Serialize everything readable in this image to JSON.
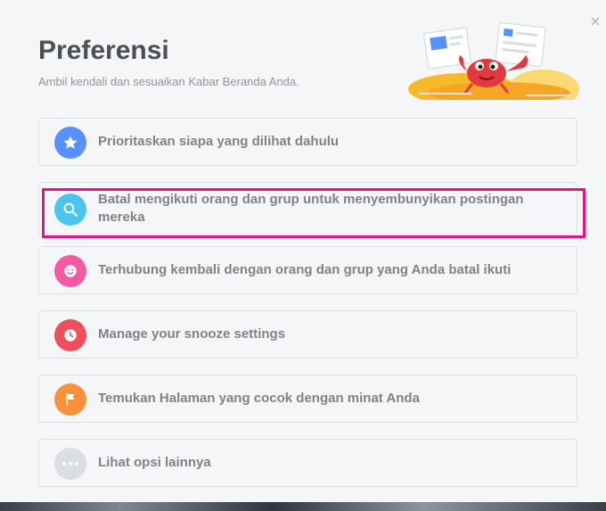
{
  "dialog": {
    "title": "Preferensi",
    "subtitle": "Ambil kendali dan sesuaikan Kabar Beranda Anda.",
    "close_glyph": "×"
  },
  "options": [
    {
      "label": "Prioritaskan siapa yang dilihat dahulu",
      "icon": "star-icon",
      "color": "#5890ff"
    },
    {
      "label": "Batal mengikuti orang dan grup untuk menyembunyikan postingan mereka",
      "icon": "search-icon",
      "color": "#4dc4f0",
      "highlighted": true
    },
    {
      "label": "Terhubung kembali dengan orang dan grup yang Anda batal ikuti",
      "icon": "smiley-icon",
      "color": "#f35aa3"
    },
    {
      "label": "Manage your snooze settings",
      "icon": "clock-icon",
      "color": "#ef4e5c"
    },
    {
      "label": "Temukan Halaman yang cocok dengan minat Anda",
      "icon": "flag-icon",
      "color": "#f7923a"
    },
    {
      "label": "Lihat opsi lainnya",
      "icon": "more-icon",
      "color": "#dadde1"
    }
  ],
  "colors": {
    "highlight_border": "#e8137f",
    "background": "#f5f6f7",
    "text": "#7f8389"
  }
}
